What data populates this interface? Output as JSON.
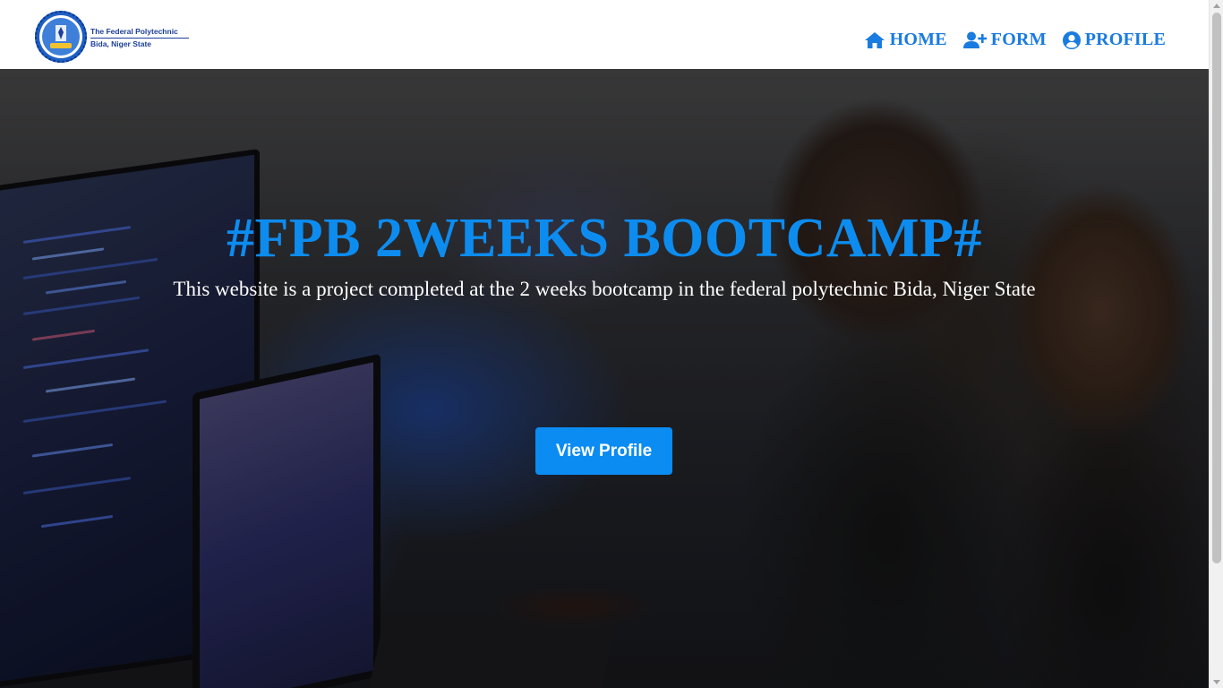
{
  "header": {
    "logo_line1": "The Federal Polytechnic",
    "logo_line2": "Bida, Niger State",
    "nav": [
      {
        "label": "HOME",
        "icon": "home-icon"
      },
      {
        "label": "FORM",
        "icon": "user-plus-icon"
      },
      {
        "label": "PROFILE",
        "icon": "user-circle-icon"
      }
    ]
  },
  "hero": {
    "title": "#FPB 2WEEKS BOOTCAMP#",
    "subtitle": "This website is a project completed at the 2 weeks bootcamp in the federal polytechnic Bida, Niger State",
    "cta_label": "View Profile"
  },
  "colors": {
    "accent": "#0b8cf2",
    "nav_text": "#1a7be0",
    "logo_blue": "#1c3f9a"
  }
}
